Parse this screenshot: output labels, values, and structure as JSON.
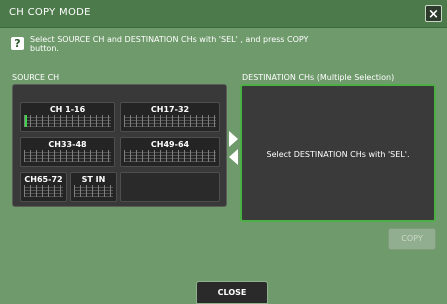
{
  "title_bar": {
    "title": "CH COPY MODE",
    "close_glyph": "×"
  },
  "instruction": {
    "help_icon": "?",
    "text": "Select SOURCE CH and DESTINATION CHs with 'SEL' , and press COPY button."
  },
  "source": {
    "label": "SOURCE CH",
    "buttons": [
      {
        "label": "CH 1-16",
        "selected_fader": true
      },
      {
        "label": "CH17-32"
      },
      {
        "label": "CH33-48"
      },
      {
        "label": "CH49-64"
      },
      {
        "label": "CH65-72"
      },
      {
        "label": "ST IN"
      }
    ]
  },
  "destination": {
    "label": "DESTINATION CHs (Multiple Selection)",
    "message": "Select DESTINATION CHs with 'SEL'."
  },
  "buttons": {
    "copy": "COPY",
    "close": "CLOSE"
  },
  "colors": {
    "background": "#6f9a6c",
    "titlebar": "#4c7a4a",
    "dest_border": "#4caf45",
    "panel": "#393939"
  }
}
